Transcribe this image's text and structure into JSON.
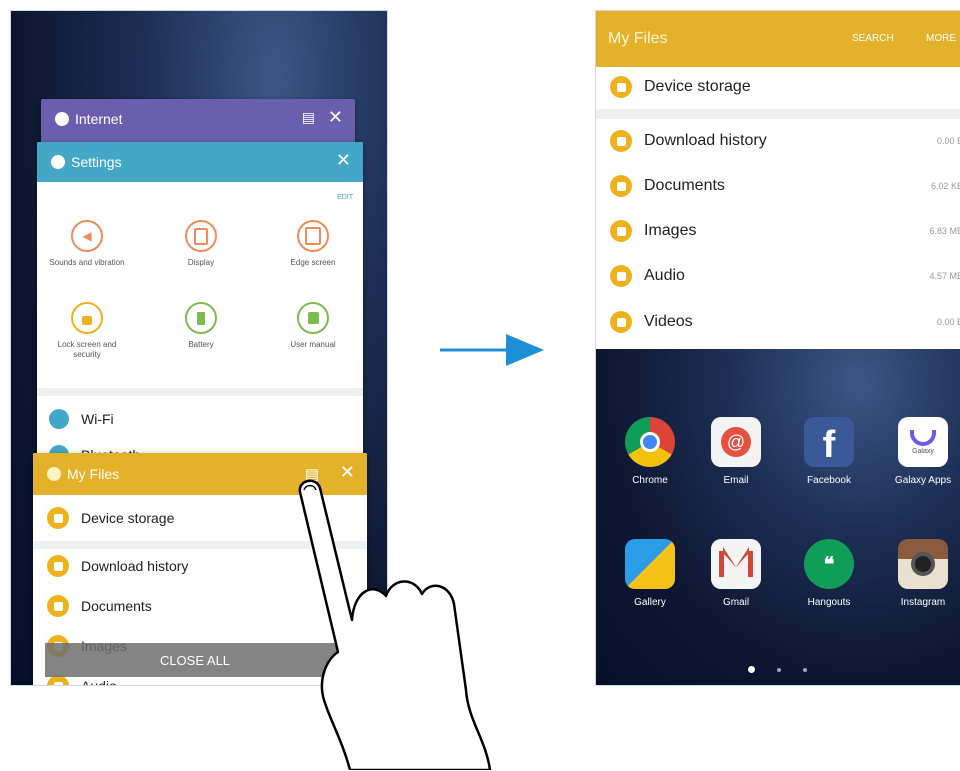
{
  "left_screen": {
    "cards": {
      "internet": {
        "title": "Internet",
        "color": "#6a5fae"
      },
      "settings": {
        "title": "Settings",
        "color": "#43a7c7",
        "edit": "EDIT",
        "items": [
          {
            "label": "Sounds and vibration",
            "icon": "speaker-icon",
            "color": "#f08b5a"
          },
          {
            "label": "Display",
            "icon": "display-icon",
            "color": "#f08b5a"
          },
          {
            "label": "Edge screen",
            "icon": "edge-screen-icon",
            "color": "#f08b5a"
          },
          {
            "label": "Lock screen and security",
            "icon": "lock-icon",
            "color": "#efb21d"
          },
          {
            "label": "Battery",
            "icon": "battery-icon",
            "color": "#7cbb4e"
          },
          {
            "label": "User manual",
            "icon": "manual-icon",
            "color": "#7cbb4e"
          }
        ],
        "list": [
          {
            "label": "Wi-Fi",
            "icon": "wifi-icon"
          },
          {
            "label": "Bluetooth",
            "icon": "bluetooth-icon"
          }
        ]
      },
      "myfiles": {
        "title": "My Files",
        "color": "#e3b12a",
        "rows": [
          "Device storage",
          "Download history",
          "Documents",
          "Images",
          "Audio"
        ]
      }
    },
    "close_all": "CLOSE ALL"
  },
  "right_screen": {
    "header": {
      "title": "My Files",
      "search": "SEARCH",
      "more": "MORE",
      "color": "#e3b12a"
    },
    "device_storage": "Device storage",
    "rows": [
      {
        "name": "Download history",
        "size": "0.00 B"
      },
      {
        "name": "Documents",
        "size": "6.02 KB"
      },
      {
        "name": "Images",
        "size": "6.83 MB"
      },
      {
        "name": "Audio",
        "size": "4.57 MB"
      },
      {
        "name": "Videos",
        "size": "0.00 B"
      }
    ],
    "apps": [
      {
        "label": "Chrome",
        "icon": "chrome-icon"
      },
      {
        "label": "Email",
        "icon": "email-icon"
      },
      {
        "label": "Facebook",
        "icon": "facebook-icon"
      },
      {
        "label": "Galaxy Apps",
        "icon": "galaxy-apps-icon",
        "icon_text": "Galaxy"
      },
      {
        "label": "Gallery",
        "icon": "gallery-icon"
      },
      {
        "label": "Gmail",
        "icon": "gmail-icon"
      },
      {
        "label": "Hangouts",
        "icon": "hangouts-icon"
      },
      {
        "label": "Instagram",
        "icon": "instagram-icon"
      }
    ]
  },
  "arrow_color": "#1e8fd6"
}
